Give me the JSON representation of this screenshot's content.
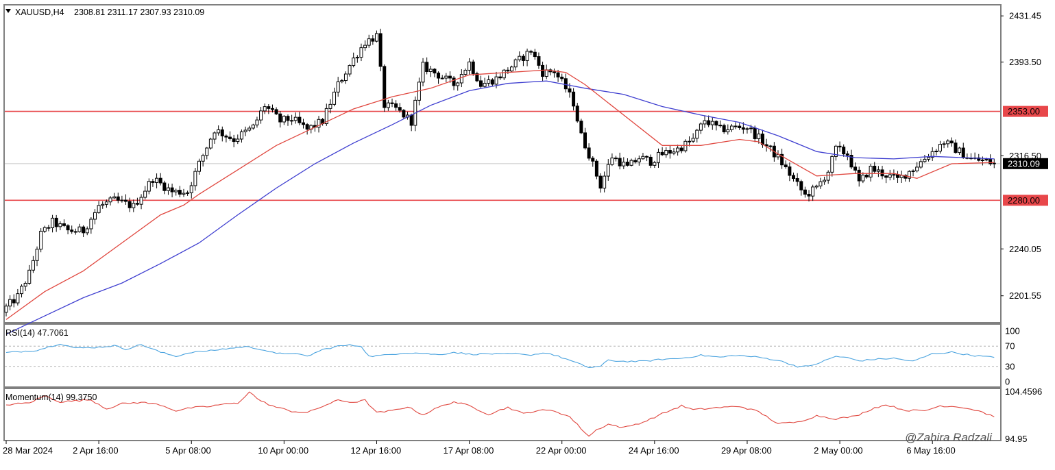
{
  "header": {
    "symbol": "XAUUSD,H4",
    "ohlc": "2308.81 2311.17 2307.93 2310.09"
  },
  "watermark": "@Zahira Radzali",
  "colors": {
    "bull_body": "#ffffff",
    "bear_body": "#000000",
    "ma_fast": "#e0473f",
    "ma_slow": "#3f3fd0",
    "hline": "#e8474a",
    "price_line": "#c8c8c8",
    "rsi": "#4aa3df",
    "momentum": "#e0473f",
    "current_label_bg": "#000000"
  },
  "chart_data": [
    {
      "type": "candlestick",
      "title": "XAUUSD,H4",
      "x_labels": [
        "28 Mar 2024",
        "2 Apr 16:00",
        "5 Apr 08:00",
        "10 Apr 00:00",
        "12 Apr 16:00",
        "17 Apr 08:00",
        "22 Apr 00:00",
        "24 Apr 16:00",
        "29 Apr 08:00",
        "2 May 00:00",
        "6 May 16:00"
      ],
      "x_label_index": [
        0,
        24,
        48,
        72,
        96,
        120,
        144,
        168,
        192,
        216,
        240
      ],
      "y_ticks": [
        "2431.45",
        "2393.50",
        "2316.50",
        "2240.05",
        "2201.55"
      ],
      "y_tick_values": [
        2431.45,
        2393.5,
        2316.5,
        2240.05,
        2201.55
      ],
      "ylim": [
        2180,
        2440
      ],
      "current_price": 2310.09,
      "current_price_label": "2310.09",
      "hlines": [
        {
          "value": 2353.0,
          "label": "2353.00"
        },
        {
          "value": 2280.0,
          "label": "2280.00"
        }
      ],
      "close_path": [
        [
          0,
          2192
        ],
        [
          3,
          2201
        ],
        [
          6,
          2220
        ],
        [
          9,
          2252
        ],
        [
          12,
          2262
        ],
        [
          16,
          2255
        ],
        [
          20,
          2255
        ],
        [
          24,
          2275
        ],
        [
          28,
          2280
        ],
        [
          33,
          2275
        ],
        [
          38,
          2298
        ],
        [
          43,
          2287
        ],
        [
          47,
          2287
        ],
        [
          50,
          2310
        ],
        [
          54,
          2338
        ],
        [
          59,
          2330
        ],
        [
          64,
          2340
        ],
        [
          67,
          2358
        ],
        [
          71,
          2345
        ],
        [
          74,
          2347
        ],
        [
          78,
          2338
        ],
        [
          82,
          2345
        ],
        [
          86,
          2375
        ],
        [
          90,
          2396
        ],
        [
          93,
          2410
        ],
        [
          96,
          2415
        ],
        [
          98,
          2358
        ],
        [
          101,
          2355
        ],
        [
          105,
          2345
        ],
        [
          108,
          2390
        ],
        [
          112,
          2383
        ],
        [
          116,
          2375
        ],
        [
          120,
          2393
        ],
        [
          123,
          2375
        ],
        [
          127,
          2380
        ],
        [
          131,
          2390
        ],
        [
          136,
          2403
        ],
        [
          139,
          2385
        ],
        [
          142,
          2386
        ],
        [
          145,
          2372
        ],
        [
          147,
          2360
        ],
        [
          149,
          2333
        ],
        [
          151,
          2318
        ],
        [
          154,
          2292
        ],
        [
          157,
          2316
        ],
        [
          161,
          2307
        ],
        [
          164,
          2315
        ],
        [
          167,
          2312
        ],
        [
          170,
          2318
        ],
        [
          174,
          2322
        ],
        [
          178,
          2330
        ],
        [
          181,
          2346
        ],
        [
          185,
          2338
        ],
        [
          189,
          2340
        ],
        [
          192,
          2340
        ],
        [
          196,
          2328
        ],
        [
          200,
          2315
        ],
        [
          204,
          2297
        ],
        [
          207,
          2284
        ],
        [
          210,
          2290
        ],
        [
          213,
          2304
        ],
        [
          215,
          2322
        ],
        [
          218,
          2318
        ],
        [
          221,
          2294
        ],
        [
          224,
          2306
        ],
        [
          227,
          2302
        ],
        [
          231,
          2297
        ],
        [
          235,
          2306
        ],
        [
          240,
          2320
        ],
        [
          243,
          2328
        ],
        [
          246,
          2322
        ],
        [
          250,
          2314
        ],
        [
          254,
          2312
        ],
        [
          256,
          2310
        ]
      ],
      "ma_fast_path": [
        [
          0,
          2182
        ],
        [
          10,
          2205
        ],
        [
          20,
          2222
        ],
        [
          30,
          2245
        ],
        [
          40,
          2268
        ],
        [
          46,
          2276
        ],
        [
          50,
          2285
        ],
        [
          60,
          2305
        ],
        [
          70,
          2325
        ],
        [
          80,
          2340
        ],
        [
          90,
          2355
        ],
        [
          100,
          2365
        ],
        [
          110,
          2372
        ],
        [
          120,
          2383
        ],
        [
          130,
          2385
        ],
        [
          140,
          2387
        ],
        [
          145,
          2385
        ],
        [
          150,
          2375
        ],
        [
          160,
          2350
        ],
        [
          170,
          2325
        ],
        [
          180,
          2325
        ],
        [
          190,
          2330
        ],
        [
          195,
          2328
        ],
        [
          200,
          2318
        ],
        [
          210,
          2300
        ],
        [
          220,
          2302
        ],
        [
          230,
          2302
        ],
        [
          236,
          2298
        ],
        [
          245,
          2310
        ],
        [
          256,
          2311
        ]
      ],
      "ma_slow_path": [
        [
          0,
          2170
        ],
        [
          10,
          2185
        ],
        [
          20,
          2200
        ],
        [
          30,
          2212
        ],
        [
          40,
          2228
        ],
        [
          50,
          2245
        ],
        [
          60,
          2268
        ],
        [
          70,
          2290
        ],
        [
          80,
          2310
        ],
        [
          90,
          2327
        ],
        [
          100,
          2342
        ],
        [
          110,
          2358
        ],
        [
          120,
          2370
        ],
        [
          130,
          2376
        ],
        [
          140,
          2378
        ],
        [
          150,
          2372
        ],
        [
          160,
          2367
        ],
        [
          170,
          2357
        ],
        [
          180,
          2350
        ],
        [
          190,
          2344
        ],
        [
          200,
          2333
        ],
        [
          210,
          2320
        ],
        [
          220,
          2315
        ],
        [
          230,
          2314
        ],
        [
          240,
          2316
        ],
        [
          256,
          2314
        ]
      ]
    },
    {
      "type": "line",
      "title": "RSI(14) 47.7061",
      "y_ticks": [
        "100",
        "70",
        "30",
        "0"
      ],
      "y_tick_values": [
        100,
        70,
        30,
        0
      ],
      "levels": [
        70,
        30
      ],
      "ylim": [
        0,
        100
      ],
      "points": [
        [
          0,
          57
        ],
        [
          8,
          62
        ],
        [
          14,
          75
        ],
        [
          18,
          66
        ],
        [
          24,
          68
        ],
        [
          28,
          71
        ],
        [
          31,
          64
        ],
        [
          35,
          73
        ],
        [
          40,
          58
        ],
        [
          44,
          50
        ],
        [
          48,
          58
        ],
        [
          52,
          60
        ],
        [
          56,
          64
        ],
        [
          62,
          69
        ],
        [
          66,
          64
        ],
        [
          70,
          55
        ],
        [
          74,
          56
        ],
        [
          78,
          50
        ],
        [
          82,
          63
        ],
        [
          86,
          70
        ],
        [
          89,
          72
        ],
        [
          92,
          70
        ],
        [
          94,
          50
        ],
        [
          98,
          52
        ],
        [
          103,
          57
        ],
        [
          108,
          56
        ],
        [
          112,
          53
        ],
        [
          116,
          58
        ],
        [
          120,
          54
        ],
        [
          125,
          55
        ],
        [
          129,
          54
        ],
        [
          132,
          55
        ],
        [
          135,
          52
        ],
        [
          140,
          57
        ],
        [
          145,
          45
        ],
        [
          148,
          36
        ],
        [
          151,
          28
        ],
        [
          154,
          30
        ],
        [
          156,
          42
        ],
        [
          160,
          40
        ],
        [
          165,
          40
        ],
        [
          170,
          44
        ],
        [
          175,
          46
        ],
        [
          180,
          52
        ],
        [
          185,
          48
        ],
        [
          189,
          52
        ],
        [
          195,
          48
        ],
        [
          200,
          42
        ],
        [
          205,
          30
        ],
        [
          208,
          30
        ],
        [
          211,
          38
        ],
        [
          215,
          50
        ],
        [
          218,
          47
        ],
        [
          221,
          41
        ],
        [
          225,
          44
        ],
        [
          230,
          46
        ],
        [
          235,
          40
        ],
        [
          240,
          55
        ],
        [
          245,
          58
        ],
        [
          250,
          52
        ],
        [
          256,
          47.7
        ]
      ]
    },
    {
      "type": "line",
      "title": "Momentum(14) 99.3750",
      "y_ticks": [
        "104.4596",
        "94.95"
      ],
      "y_tick_values": [
        104.4596,
        94.95
      ],
      "ylim": [
        94.9,
        104.8
      ],
      "points": [
        [
          0,
          101.8
        ],
        [
          6,
          102.2
        ],
        [
          10,
          103.6
        ],
        [
          14,
          102.4
        ],
        [
          18,
          102.6
        ],
        [
          22,
          102.8
        ],
        [
          26,
          101.0
        ],
        [
          30,
          102.0
        ],
        [
          35,
          102.3
        ],
        [
          40,
          101.8
        ],
        [
          44,
          100.6
        ],
        [
          48,
          101.2
        ],
        [
          52,
          101.4
        ],
        [
          56,
          101.9
        ],
        [
          60,
          102.1
        ],
        [
          63,
          104.4
        ],
        [
          66,
          102.5
        ],
        [
          70,
          101.3
        ],
        [
          74,
          100.5
        ],
        [
          78,
          100.2
        ],
        [
          82,
          101.5
        ],
        [
          86,
          102.7
        ],
        [
          90,
          102.3
        ],
        [
          93,
          102.7
        ],
        [
          96,
          100.2
        ],
        [
          100,
          100.6
        ],
        [
          104,
          101.4
        ],
        [
          108,
          99.8
        ],
        [
          112,
          101.3
        ],
        [
          116,
          102.4
        ],
        [
          120,
          101.6
        ],
        [
          125,
          99.9
        ],
        [
          130,
          101.3
        ],
        [
          134,
          100.0
        ],
        [
          138,
          100.7
        ],
        [
          142,
          100.6
        ],
        [
          146,
          99.4
        ],
        [
          149,
          97.0
        ],
        [
          151,
          95.5
        ],
        [
          153,
          96.8
        ],
        [
          156,
          97.9
        ],
        [
          160,
          97.2
        ],
        [
          165,
          98.3
        ],
        [
          170,
          100.0
        ],
        [
          175,
          101.6
        ],
        [
          178,
          100.8
        ],
        [
          184,
          101.2
        ],
        [
          190,
          101.5
        ],
        [
          195,
          100.4
        ],
        [
          200,
          98.0
        ],
        [
          205,
          98.3
        ],
        [
          210,
          99.6
        ],
        [
          215,
          99.0
        ],
        [
          220,
          99.5
        ],
        [
          225,
          101.2
        ],
        [
          228,
          101.8
        ],
        [
          233,
          100.7
        ],
        [
          238,
          100.6
        ],
        [
          242,
          101.6
        ],
        [
          247,
          101.4
        ],
        [
          252,
          100.6
        ],
        [
          256,
          99.375
        ]
      ]
    }
  ]
}
